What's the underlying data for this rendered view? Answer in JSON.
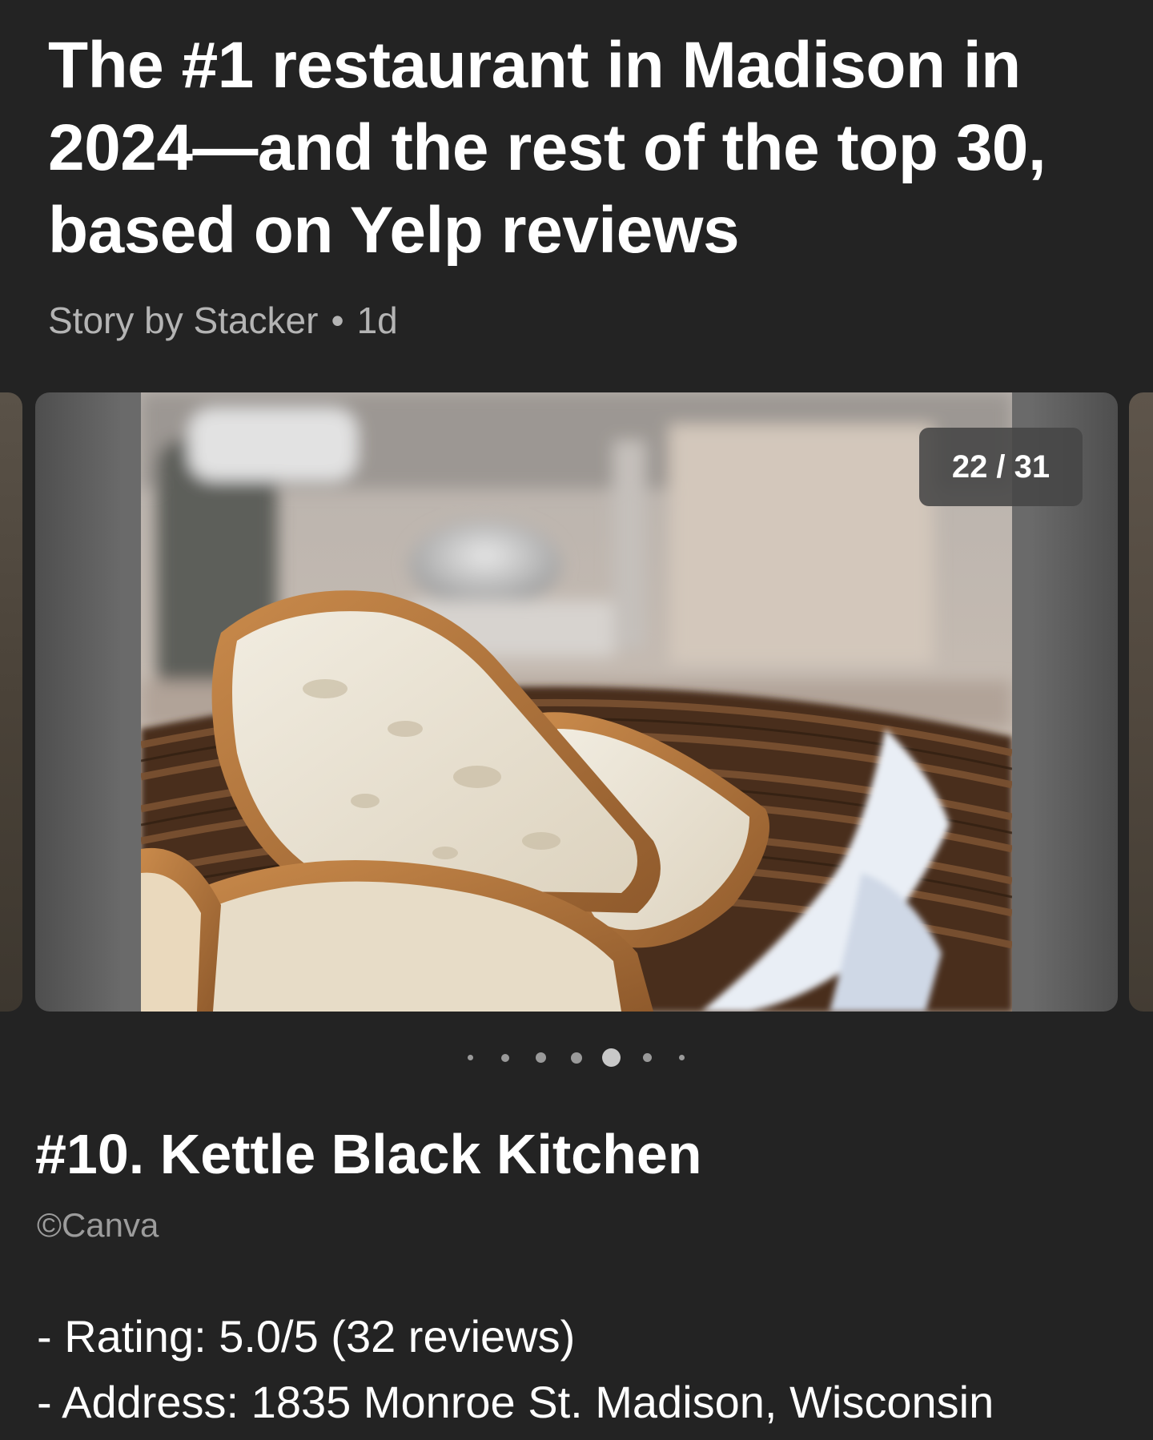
{
  "article": {
    "headline": "The #1 restaurant in Madison in 2024—and the rest of the top 30, based on Yelp reviews",
    "byline_source": "Story by Stacker",
    "byline_separator": "•",
    "byline_age": "1d"
  },
  "carousel": {
    "counter": "22 / 31",
    "current_index": 22,
    "total": 31,
    "image_subject": "bread-basket-photo",
    "dots_count": 7,
    "active_dot": 4
  },
  "slide": {
    "title": "#10. Kettle Black Kitchen",
    "credit": "©Canva",
    "details": [
      "- Rating: 5.0/5 (32 reviews)",
      "- Address: 1835 Monroe St. Madison, Wisconsin"
    ]
  },
  "colors": {
    "background": "#232323",
    "text_primary": "#ffffff",
    "text_secondary": "#b4b4b4",
    "counter_bg": "#464646"
  }
}
